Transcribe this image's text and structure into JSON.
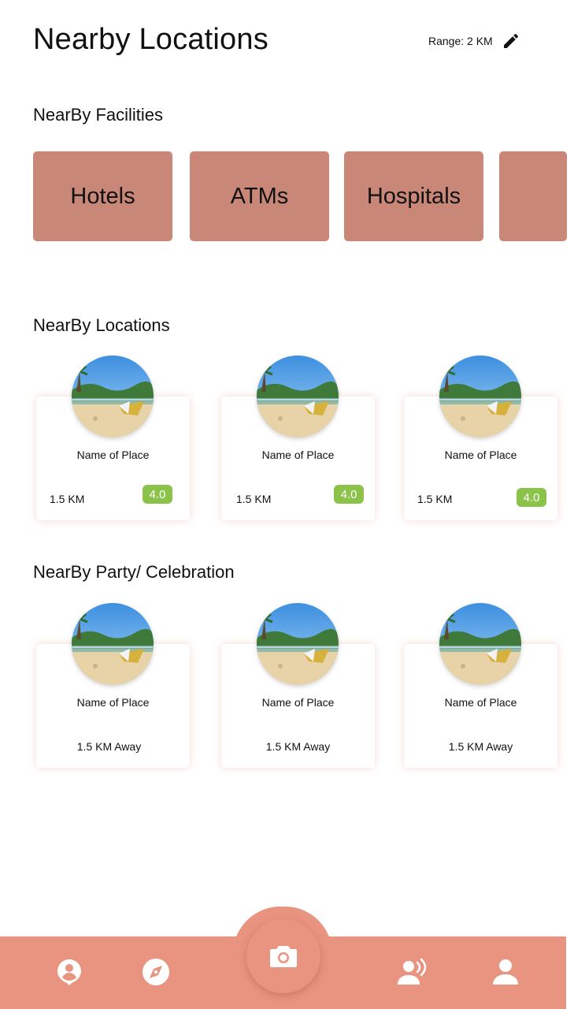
{
  "header": {
    "title": "Nearby Locations",
    "range_label": "Range: 2 KM"
  },
  "facilities": {
    "title": "NearBy Facilities",
    "items": [
      {
        "label": "Hotels"
      },
      {
        "label": "ATMs"
      },
      {
        "label": "Hospitals"
      },
      {
        "label": ""
      }
    ]
  },
  "locations": {
    "title": "NearBy Locations",
    "items": [
      {
        "name": "Name of Place",
        "distance": "1.5 KM",
        "rating": "4.0"
      },
      {
        "name": "Name of Place",
        "distance": "1.5 KM",
        "rating": "4.0"
      },
      {
        "name": "Name of Place",
        "distance": "1.5 KM",
        "rating": "4.0"
      }
    ]
  },
  "party": {
    "title": "NearBy Party/ Celebration",
    "items": [
      {
        "name": "Name of Place",
        "distance": "1.5 KM Away"
      },
      {
        "name": "Name of Place",
        "distance": "1.5 KM Away"
      },
      {
        "name": "Name of Place",
        "distance": "1.5 KM Away"
      }
    ]
  },
  "nav": {
    "items": [
      {
        "icon": "location-user-icon"
      },
      {
        "icon": "compass-icon"
      },
      {
        "icon": "camera-icon"
      },
      {
        "icon": "voice-user-icon"
      },
      {
        "icon": "profile-icon"
      }
    ]
  },
  "colors": {
    "accent": "#e99480",
    "facility_tile": "#c98778",
    "rating_badge": "#8bc34a"
  }
}
